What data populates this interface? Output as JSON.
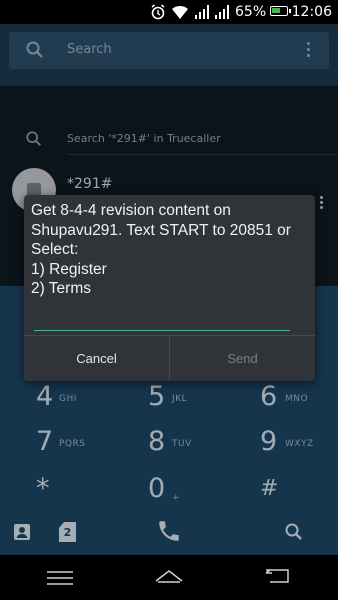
{
  "status_bar": {
    "battery_percent": "65%",
    "battery_level": 0.65,
    "time": "12:06",
    "icons": [
      "alarm-icon",
      "wifi-icon",
      "signal-icon",
      "signal-icon",
      "battery-icon"
    ]
  },
  "search": {
    "placeholder": "Search"
  },
  "truecaller_row": {
    "text": "Search '*291#' in Truecaller"
  },
  "contact": {
    "number": "*291#"
  },
  "dialog": {
    "message": "Get 8-4-4 revision content on Shupavu291. Text START to 20851 or Select:\n1) Register\n2) Terms",
    "input_value": "",
    "cancel_label": "Cancel",
    "send_label": "Send"
  },
  "dialpad": {
    "keys": [
      {
        "digit": "4",
        "letters": "GHI"
      },
      {
        "digit": "5",
        "letters": "JKL"
      },
      {
        "digit": "6",
        "letters": "MNO"
      },
      {
        "digit": "7",
        "letters": "PQRS"
      },
      {
        "digit": "8",
        "letters": "TUV"
      },
      {
        "digit": "9",
        "letters": "WXYZ"
      },
      {
        "digit": "*",
        "letters": ""
      },
      {
        "digit": "0",
        "letters": "+"
      },
      {
        "digit": "#",
        "letters": ""
      }
    ],
    "sim_badge": "2"
  },
  "colors": {
    "accent": "#4fb5a0",
    "dialpad_bg": "#1d4767",
    "dialog_bg": "#303338"
  }
}
